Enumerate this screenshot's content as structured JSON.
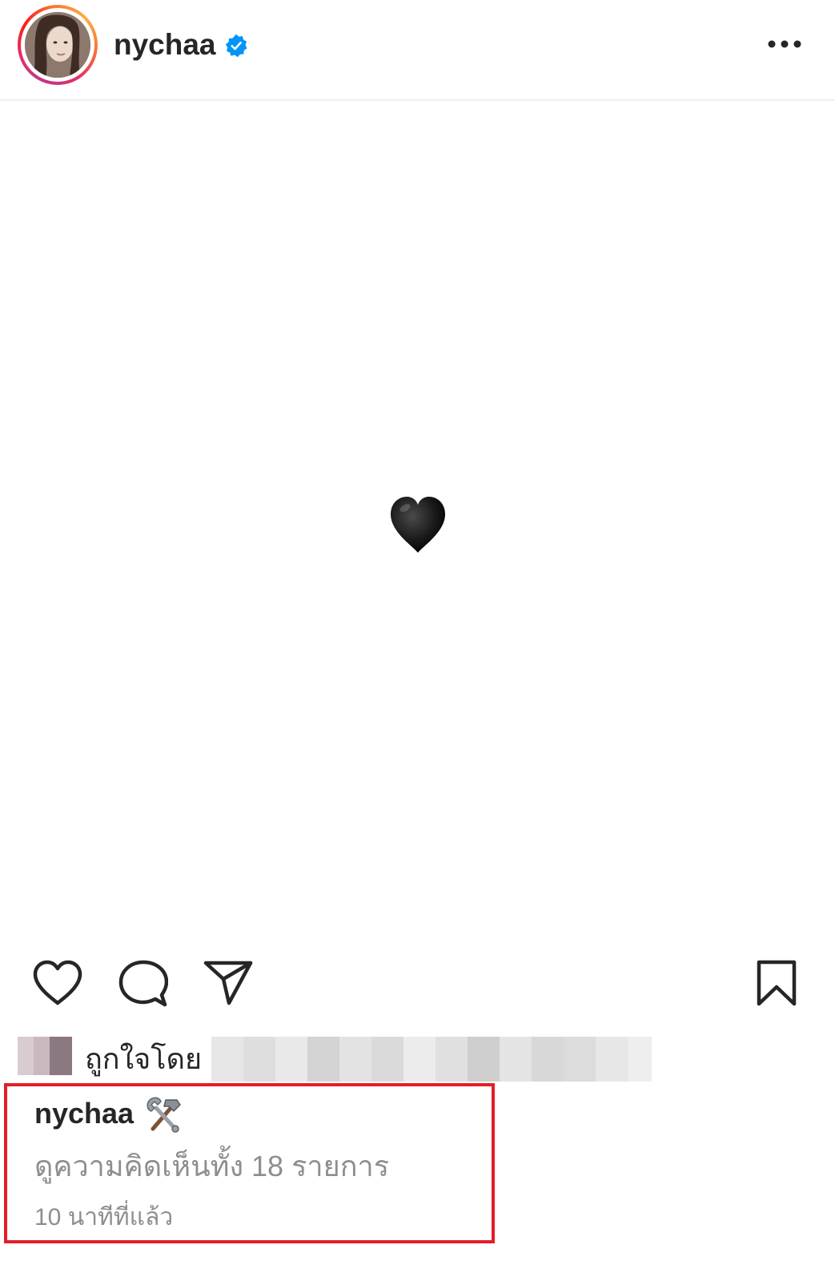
{
  "header": {
    "username": "nychaa",
    "verified_icon": "verified-badge-icon",
    "more_icon": "more-options-icon"
  },
  "post": {
    "image_content_icon": "black-heart-emoji"
  },
  "actions": {
    "like_icon": "heart-icon",
    "comment_icon": "comment-icon",
    "share_icon": "send-icon",
    "save_icon": "bookmark-icon"
  },
  "likes": {
    "label": "ถูกใจโดย"
  },
  "caption": {
    "username": "nychaa",
    "emoji": "hammer-and-wrench-emoji",
    "view_comments": "ดูความคิดเห็นทั้ง 18 รายการ",
    "timestamp": "10 นาทีที่แล้ว"
  },
  "colors": {
    "highlight_border": "#e41e26",
    "verified_blue": "#0095f6",
    "secondary_text": "#8e8e8e"
  }
}
